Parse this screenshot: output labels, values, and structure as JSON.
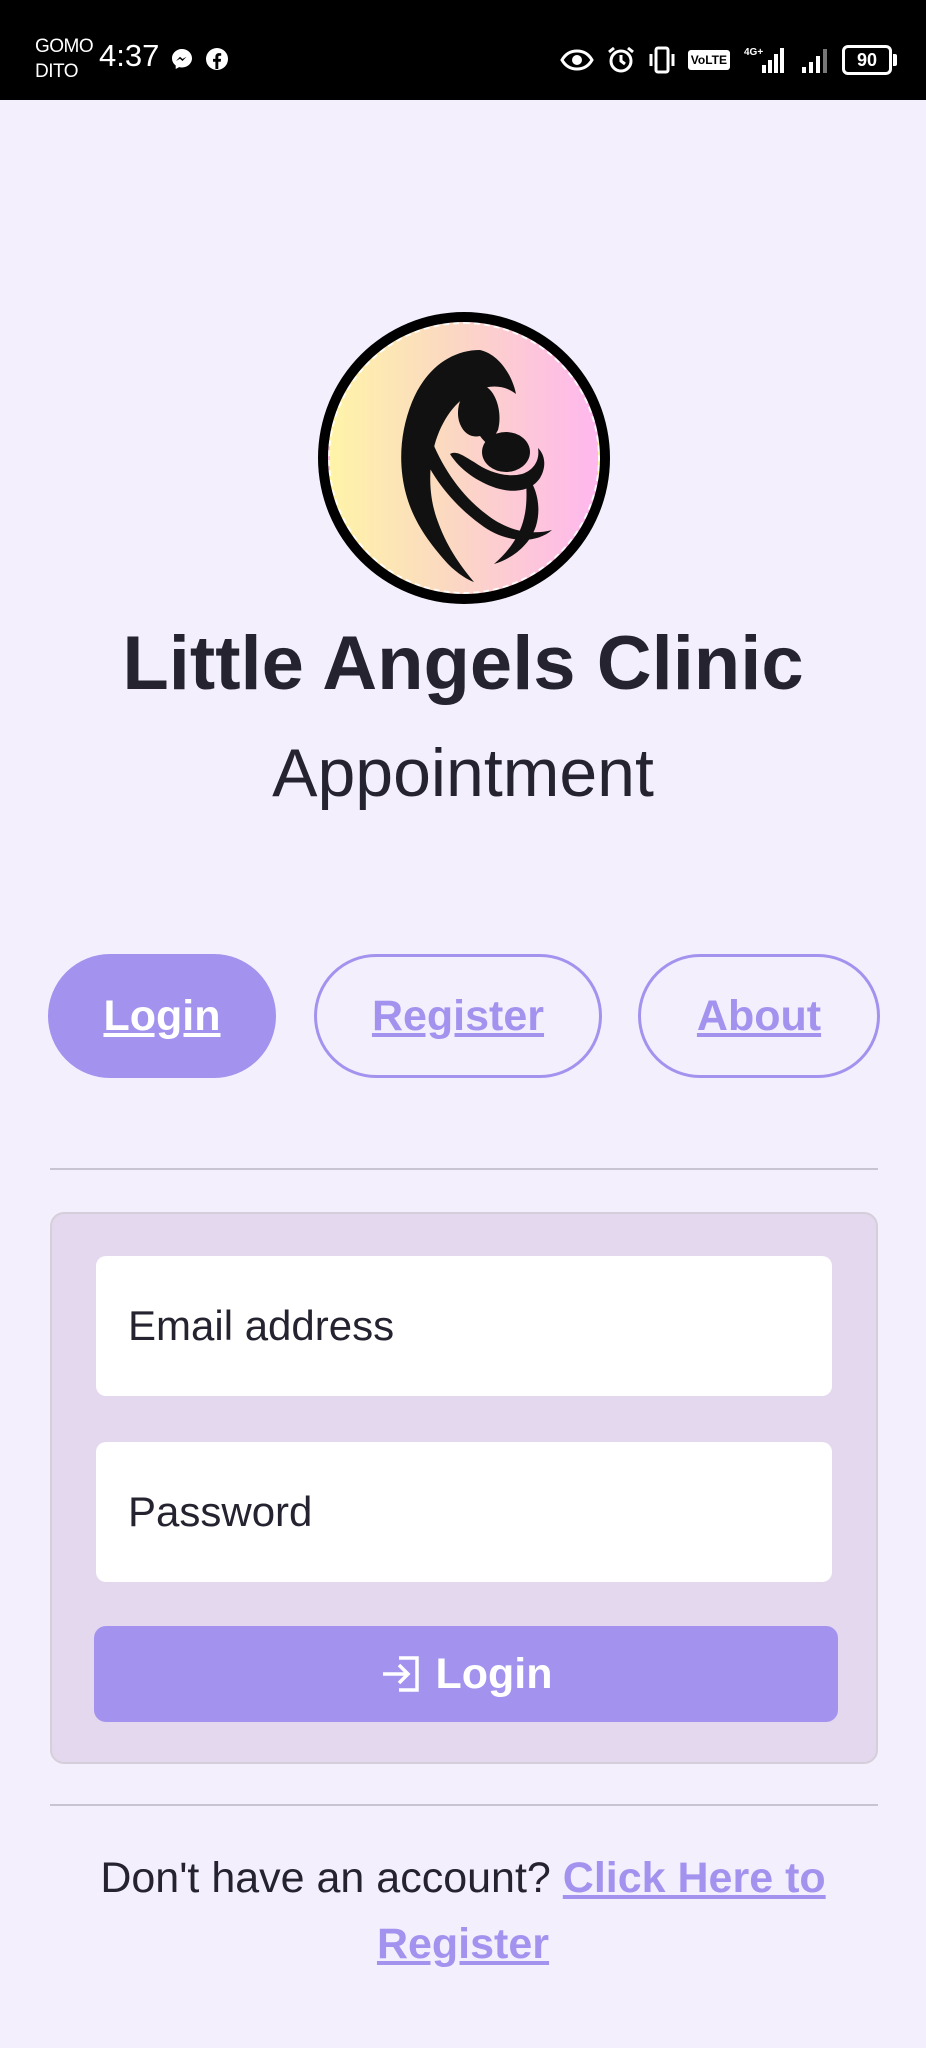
{
  "status_bar": {
    "carrier_line1": "GOMO",
    "carrier_line2": "DITO",
    "time": "4:37",
    "volte": "VoLTE",
    "network": "4G+",
    "battery": "90",
    "icons": [
      "messenger-icon",
      "facebook-icon",
      "eye-icon",
      "alarm-icon",
      "vibrate-icon",
      "volte-icon",
      "signal-icon",
      "signal-icon",
      "battery-icon"
    ]
  },
  "header": {
    "title": "Little Angels Clinic",
    "subtitle": "Appointment"
  },
  "tabs": [
    {
      "label": "Login",
      "active": true
    },
    {
      "label": "Register",
      "active": false
    },
    {
      "label": "About",
      "active": false
    }
  ],
  "form": {
    "email_placeholder": "Email address",
    "password_placeholder": "Password",
    "login_label": "Login",
    "login_icon": "login-arrow-icon"
  },
  "footer": {
    "prompt": "Don't have an account?",
    "link": "Click Here to Register"
  },
  "colors": {
    "accent": "#a393ef",
    "background": "#f4effd",
    "card": "#e4d8ef",
    "text": "#252330"
  }
}
